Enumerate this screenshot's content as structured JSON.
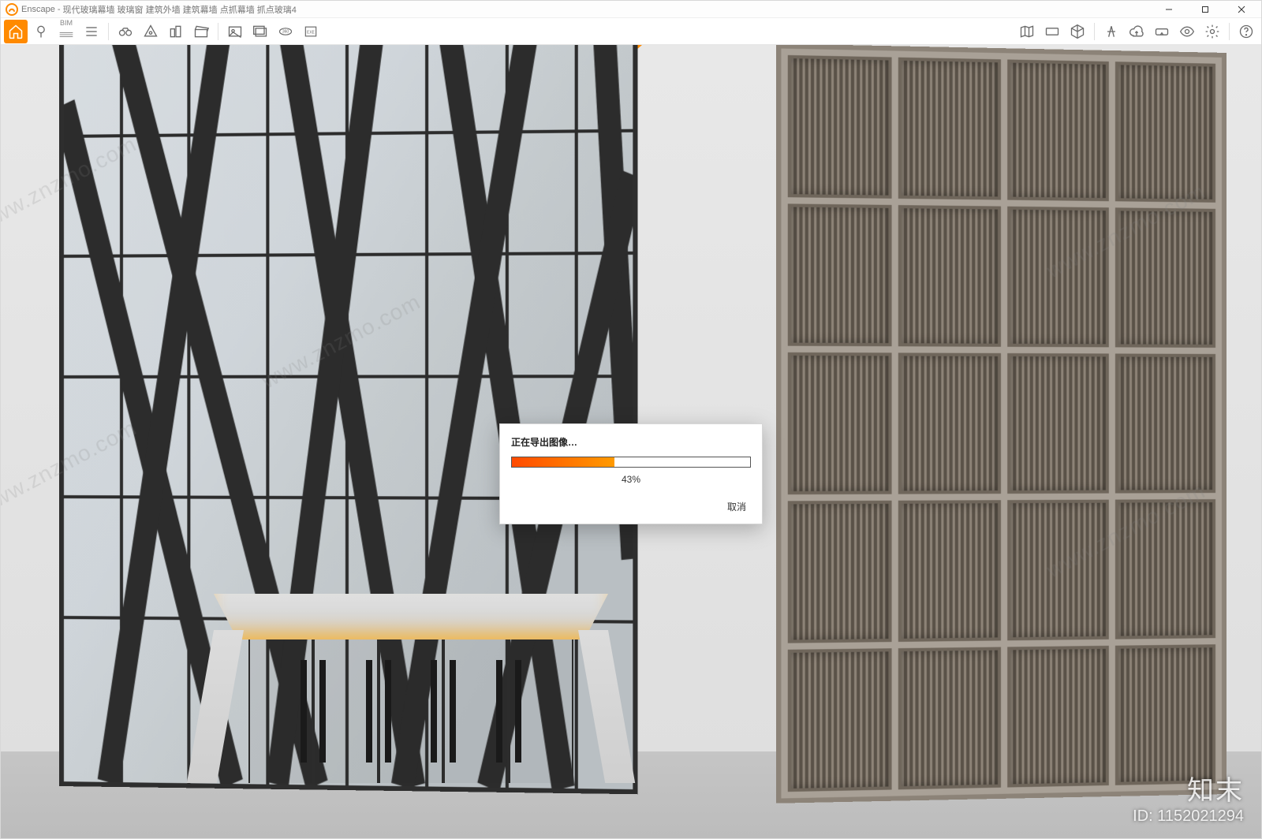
{
  "app": {
    "name": "Enscape",
    "title_suffix": "现代玻璃幕墙 玻璃窗 建筑外墙 建筑幕墙 点抓幕墙 抓点玻璃4"
  },
  "window_controls": {
    "minimize": "–",
    "maximize": "☐",
    "close": "✕"
  },
  "toolbar": {
    "left_icons": [
      "home-icon",
      "pin-icon",
      "bim-icon",
      "menu-icon",
      "binoculars-icon",
      "view-sun-icon",
      "buildings-icon",
      "clapper-icon",
      "picture-icon",
      "picture-batch-icon",
      "360-icon",
      "exe-export-icon"
    ],
    "bim_label": "BIM",
    "right_icons": [
      "map-icon",
      "keyboard-icon",
      "cube-icon",
      "divider-icon",
      "walkthrough-icon",
      "cloud-icon",
      "vr-icon",
      "eye-icon",
      "settings-icon",
      "help-icon"
    ]
  },
  "dialog": {
    "title": "正在导出图像…",
    "percent_text": "43%",
    "percent_value": 43,
    "cancel": "取消"
  },
  "watermark": {
    "diag_text": "www.znzmo.com",
    "brand": "知末",
    "id_label": "ID: 1152021294"
  }
}
